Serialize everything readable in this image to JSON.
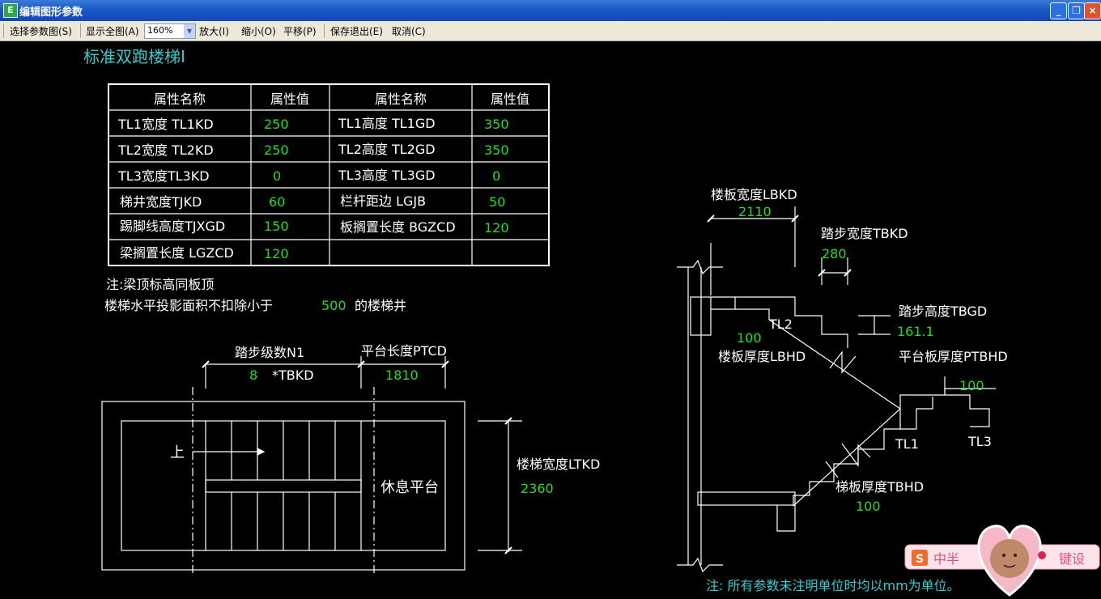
{
  "window": {
    "title": "编辑图形参数",
    "icon_glyph": "E"
  },
  "toolbar": {
    "select_param_diagram": "选择参数图(S)",
    "show_all": "显示全图(A)",
    "zoom": "160%",
    "zoom_in": "放大(I)",
    "zoom_out": "缩小(O)",
    "pan": "平移(P)",
    "save_exit": "保存退出(E)",
    "cancel": "取消(C)"
  },
  "drawing": {
    "title": "标准双跑楼梯Ⅰ",
    "table_headers": [
      "属性名称",
      "属性值",
      "属性名称",
      "属性值"
    ],
    "table_rows": [
      [
        "TL1宽度 TL1KD",
        "250",
        "TL1高度 TL1GD",
        "350"
      ],
      [
        "TL2宽度 TL2KD",
        "250",
        "TL2高度 TL2GD",
        "350"
      ],
      [
        "TL3宽度TL3KD",
        "0",
        "TL3高度 TL3GD",
        "0"
      ],
      [
        "梯井宽度TJKD",
        "60",
        "栏杆距边 LGJB",
        "50"
      ],
      [
        "踢脚线高度TJXGD",
        "150",
        "板搁置长度 BGZCD",
        "120"
      ],
      [
        "梁搁置长度 LGZCD",
        "120",
        "",
        ""
      ]
    ],
    "note_line1": "注:梁顶标高同板顶",
    "note_line2_prefix": "楼梯水平投影面积不扣除小于",
    "note_line2_value": "500",
    "note_line2_suffix": "的楼梯井",
    "plan": {
      "steps_label": "踏步级数N1",
      "steps_value": "8",
      "steps_times": "*TBKD",
      "platform_length_label": "平台长度PTCD",
      "platform_length_value": "1810",
      "up_label": "上",
      "rest_platform_label": "休息平台",
      "stair_width_label": "楼梯宽度LTKD",
      "stair_width_value": "2360"
    },
    "section": {
      "slab_width_label": "楼板宽度LBKD",
      "slab_width_value": "2110",
      "step_width_label": "踏步宽度TBKD",
      "step_width_value": "280",
      "step_height_label": "踏步高度TBGD",
      "step_height_value": "161.1",
      "tl2_label": "TL2",
      "slab_thickness_value": "100",
      "slab_thickness_label": "楼板厚度LBHD",
      "platform_slab_thickness_label": "平台板厚度PTBHD",
      "platform_slab_thickness_value": "100",
      "tl1_label": "TL1",
      "tl3_label": "TL3",
      "stair_slab_thickness_label": "梯板厚度TBHD",
      "stair_slab_thickness_value": "100"
    },
    "footer_note": "注: 所有参数未注明单位时均以mm为单位。"
  },
  "ime_toolbar": {
    "brand": "S",
    "mode": "中半",
    "soft_keyboard": "键设"
  },
  "colors": {
    "line": "#ffffff",
    "value": "#22dd22",
    "title": "#33cccc",
    "accent": "#1b58c8"
  }
}
